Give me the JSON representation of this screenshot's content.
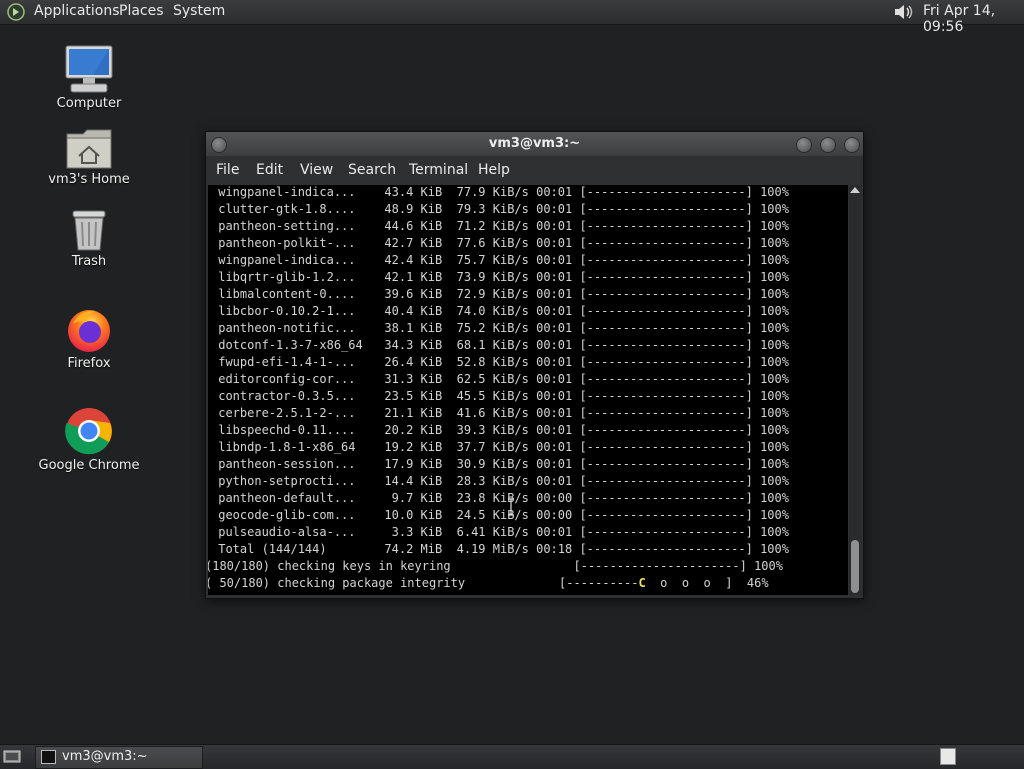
{
  "top_panel": {
    "menus": [
      "Applications",
      "Places",
      "System"
    ],
    "clock": "Fri Apr 14, 09:56",
    "icons": {
      "logo": "distro-logo-icon",
      "volume": "speaker-volume-icon"
    }
  },
  "desktop": {
    "icons": [
      {
        "label": "Computer",
        "icon": "computer-icon"
      },
      {
        "label": "vm3's Home",
        "icon": "home-folder-icon"
      },
      {
        "label": "Trash",
        "icon": "trash-icon"
      },
      {
        "label": "Firefox",
        "icon": "firefox-icon"
      },
      {
        "label": "Google Chrome",
        "icon": "chrome-icon"
      }
    ]
  },
  "terminal": {
    "title": "vm3@vm3:~",
    "menu": [
      "File",
      "Edit",
      "View",
      "Search",
      "Terminal",
      "Help"
    ],
    "lines": [
      " wingpanel-indica...    43.4 KiB  77.9 KiB/s 00:01 [----------------------] 100%",
      " clutter-gtk-1.8....    48.9 KiB  79.3 KiB/s 00:01 [----------------------] 100%",
      " pantheon-setting...    44.6 KiB  71.2 KiB/s 00:01 [----------------------] 100%",
      " pantheon-polkit-...    42.7 KiB  77.6 KiB/s 00:01 [----------------------] 100%",
      " wingpanel-indica...    42.4 KiB  75.7 KiB/s 00:01 [----------------------] 100%",
      " libqrtr-glib-1.2...    42.1 KiB  73.9 KiB/s 00:01 [----------------------] 100%",
      " libmalcontent-0....    39.6 KiB  72.9 KiB/s 00:01 [----------------------] 100%",
      " libcbor-0.10.2-1...    40.4 KiB  74.0 KiB/s 00:01 [----------------------] 100%",
      " pantheon-notific...    38.1 KiB  75.2 KiB/s 00:01 [----------------------] 100%",
      " dotconf-1.3-7-x86_64   34.3 KiB  68.1 KiB/s 00:01 [----------------------] 100%",
      " fwupd-efi-1.4-1-...    26.4 KiB  52.8 KiB/s 00:01 [----------------------] 100%",
      " editorconfig-cor...    31.3 KiB  62.5 KiB/s 00:01 [----------------------] 100%",
      " contractor-0.3.5...    23.5 KiB  45.5 KiB/s 00:01 [----------------------] 100%",
      " cerbere-2.5.1-2-...    21.1 KiB  41.6 KiB/s 00:01 [----------------------] 100%",
      " libspeechd-0.11....    20.2 KiB  39.3 KiB/s 00:01 [----------------------] 100%",
      " libndp-1.8-1-x86_64    19.2 KiB  37.7 KiB/s 00:01 [----------------------] 100%",
      " pantheon-session...    17.9 KiB  30.9 KiB/s 00:01 [----------------------] 100%",
      " python-setprocti...    14.4 KiB  28.3 KiB/s 00:01 [----------------------] 100%",
      " pantheon-default...     9.7 KiB  23.8 KiB/s 00:00 [----------------------] 100%",
      " geocode-glib-com...    10.0 KiB  24.5 KiB/s 00:00 [----------------------] 100%",
      " pulseaudio-alsa-...     3.3 KiB  6.41 KiB/s 00:01 [----------------------] 100%",
      " Total (144/144)        74.2 MiB  4.19 MiB/s 00:18 [----------------------] 100%",
      "(180/180) checking keys in keyring                 [----------------------] 100%"
    ],
    "last_line": {
      "prefix": "( 50/180) checking package integrity             [----------",
      "pacman": "C",
      "suffix": "  o  o  o  ]  46%"
    },
    "integrity_progress_percent": 46
  },
  "bottom_panel": {
    "task_label": "vm3@vm3:~",
    "icons": {
      "show_desktop": "show-desktop-icon",
      "task": "terminal-icon",
      "workspace": "workspace-switcher-icon"
    }
  }
}
